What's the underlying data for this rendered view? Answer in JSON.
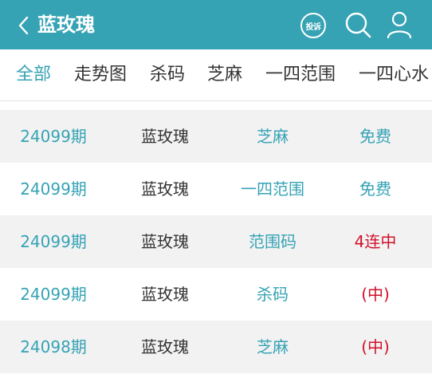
{
  "header": {
    "title": "蓝玫瑰",
    "complaint_label": "投诉",
    "background": "#36a3b5"
  },
  "tabs": [
    {
      "label": "全部",
      "active": true
    },
    {
      "label": "走势图",
      "active": false
    },
    {
      "label": "杀码",
      "active": false
    },
    {
      "label": "芝麻",
      "active": false
    },
    {
      "label": "一四范围",
      "active": false
    },
    {
      "label": "一四心水",
      "active": false
    }
  ],
  "rows": [
    {
      "period": "24099期",
      "name": "蓝玫瑰",
      "type": "芝麻",
      "result": "免费",
      "result_color": "blue"
    },
    {
      "period": "24099期",
      "name": "蓝玫瑰",
      "type": "一四范围",
      "result": "免费",
      "result_color": "blue"
    },
    {
      "period": "24099期",
      "name": "蓝玫瑰",
      "type": "范围码",
      "result": "4连中",
      "result_color": "red"
    },
    {
      "period": "24099期",
      "name": "蓝玫瑰",
      "type": "杀码",
      "result": "(中)",
      "result_color": "red"
    },
    {
      "period": "24098期",
      "name": "蓝玫瑰",
      "type": "芝麻",
      "result": "(中)",
      "result_color": "red"
    }
  ],
  "colors": {
    "accent": "#36a3b5",
    "highlight_red": "#d0112b",
    "row_alt": "#f2f2f2"
  },
  "icons": {
    "back": "chevron-left-icon",
    "complaint": "complaint-icon",
    "search": "search-icon",
    "user": "user-icon"
  }
}
